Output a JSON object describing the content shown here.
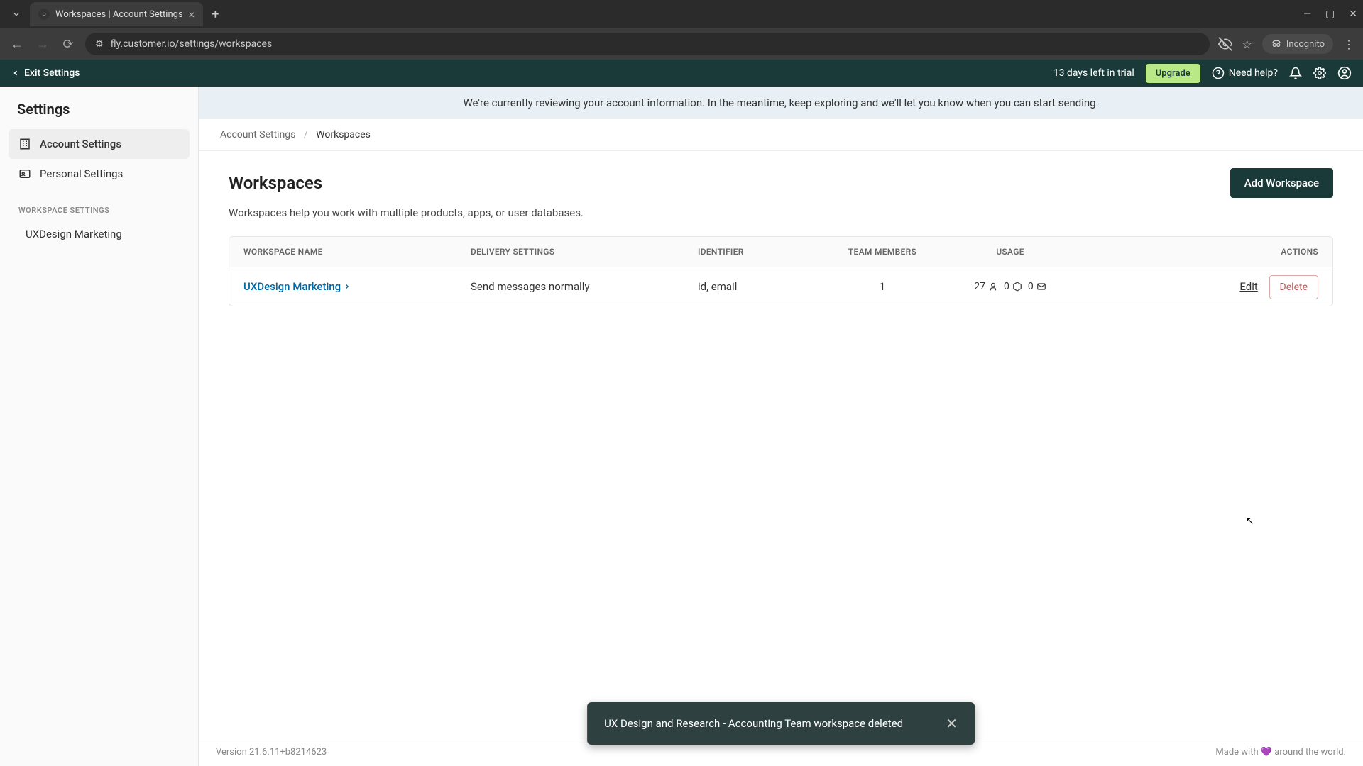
{
  "browser": {
    "tab_title": "Workspaces | Account Settings",
    "url": "fly.customer.io/settings/workspaces",
    "incognito_label": "Incognito"
  },
  "header": {
    "exit_label": "Exit Settings",
    "trial_text": "13 days left in trial",
    "upgrade_label": "Upgrade",
    "help_label": "Need help?"
  },
  "sidebar": {
    "title": "Settings",
    "items": [
      {
        "label": "Account Settings"
      },
      {
        "label": "Personal Settings"
      }
    ],
    "section_label": "WORKSPACE SETTINGS",
    "workspace_item": "UXDesign Marketing"
  },
  "banner": {
    "text": "We're currently reviewing your account information. In the meantime, keep exploring and we'll let you know when you can start sending."
  },
  "breadcrumb": {
    "root": "Account Settings",
    "current": "Workspaces"
  },
  "page": {
    "title": "Workspaces",
    "description": "Workspaces help you work with multiple products, apps, or user databases.",
    "add_button": "Add Workspace"
  },
  "table": {
    "headers": {
      "name": "WORKSPACE NAME",
      "delivery": "DELIVERY SETTINGS",
      "identifier": "IDENTIFIER",
      "members": "TEAM MEMBERS",
      "usage": "USAGE",
      "actions": "ACTIONS"
    },
    "rows": [
      {
        "name": "UXDesign Marketing",
        "delivery": "Send messages normally",
        "identifier": "id, email",
        "members": "1",
        "usage_people": "27",
        "usage_segments": "0",
        "usage_emails": "0",
        "edit_label": "Edit",
        "delete_label": "Delete"
      }
    ]
  },
  "footer": {
    "version": "Version 21.6.11+b8214623",
    "made_with_prefix": "Made with ",
    "made_with_suffix": " around the world."
  },
  "toast": {
    "message": "UX Design and Research - Accounting Team workspace deleted"
  }
}
